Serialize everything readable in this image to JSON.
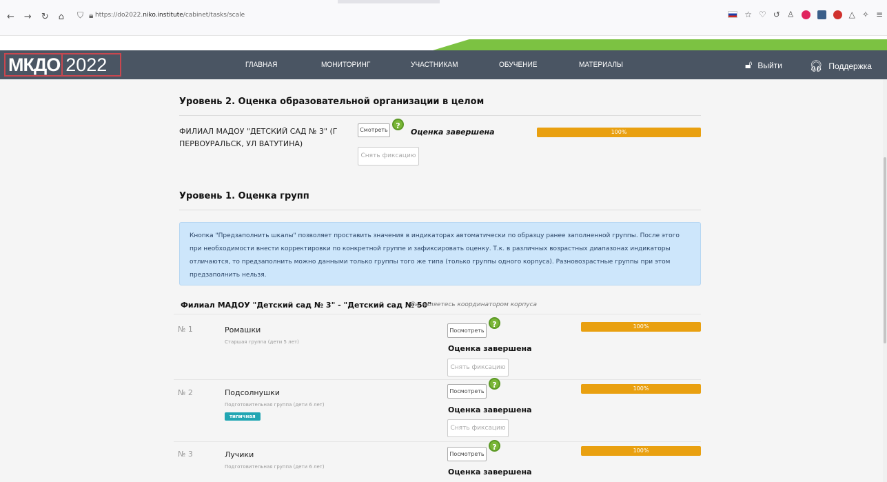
{
  "browser": {
    "url_prefix": "https://do2022.",
    "url_domain": "niko.institute",
    "url_path": "/cabinet/tasks/scale"
  },
  "header": {
    "logo_text": "МКДО",
    "logo_year": "2022",
    "nav": [
      "ГЛАВНАЯ",
      "МОНИТОРИНГ",
      "УЧАСТНИКАМ",
      "ОБУЧЕНИЕ",
      "МАТЕРИАЛЫ"
    ],
    "logout": "Выйти",
    "support": "Поддержка"
  },
  "level2": {
    "title": "Уровень 2. Оценка образовательной организации в целом",
    "org_name": "ФИЛИАЛ МАДОУ \"ДЕТСКИЙ САД № 3\" (Г ПЕРВОУРАЛЬСК, УЛ ВАТУТИНА)",
    "view_btn": "Смотреть",
    "help": "?",
    "status": "Оценка завершена",
    "progress_label": "100%",
    "progress_value": 100,
    "unfix_btn": "Снять фиксацию"
  },
  "level1": {
    "title": "Уровень 1. Оценка групп",
    "info": "Кнопка \"Предзаполнить шкалы\" позволяет проставить значения в индикаторах автоматически по образцу ранее заполненной группы. После этого при необходимости внести корректировки по конкретной группе и зафиксировать оценку. Т.к. в различных возрастных диапазонах индикаторы отличаются, то предзаполнить можно данными только группы того же типа (только группы одного корпуса). Разновозрастные группы при этом предзаполнить нельзя.",
    "branch_title": "Филиал МАДОУ \"Детский сад № 3\" - \"Детский сад № 50\"",
    "branch_note": "Вы являетесь координатором корпуса",
    "groups": [
      {
        "num": "№ 1",
        "name": "Ромашки",
        "sub": "Старшая группа (дети 5 лет)",
        "view": "Посмотреть",
        "status": "Оценка завершена",
        "unfix": "Снять фиксацию",
        "progress": "100%"
      },
      {
        "num": "№ 2",
        "name": "Подсолнушки",
        "sub": "Подготовительная группа (дети 6 лет)",
        "badge": "типичная",
        "view": "Посмотреть",
        "status": "Оценка завершена",
        "unfix": "Снять фиксацию",
        "progress": "100%"
      },
      {
        "num": "№ 3",
        "name": "Лучики",
        "sub": "Подготовительная группа (дети 6 лет)",
        "view": "Посмотреть",
        "status": "Оценка завершена",
        "progress": "100%"
      }
    ]
  }
}
